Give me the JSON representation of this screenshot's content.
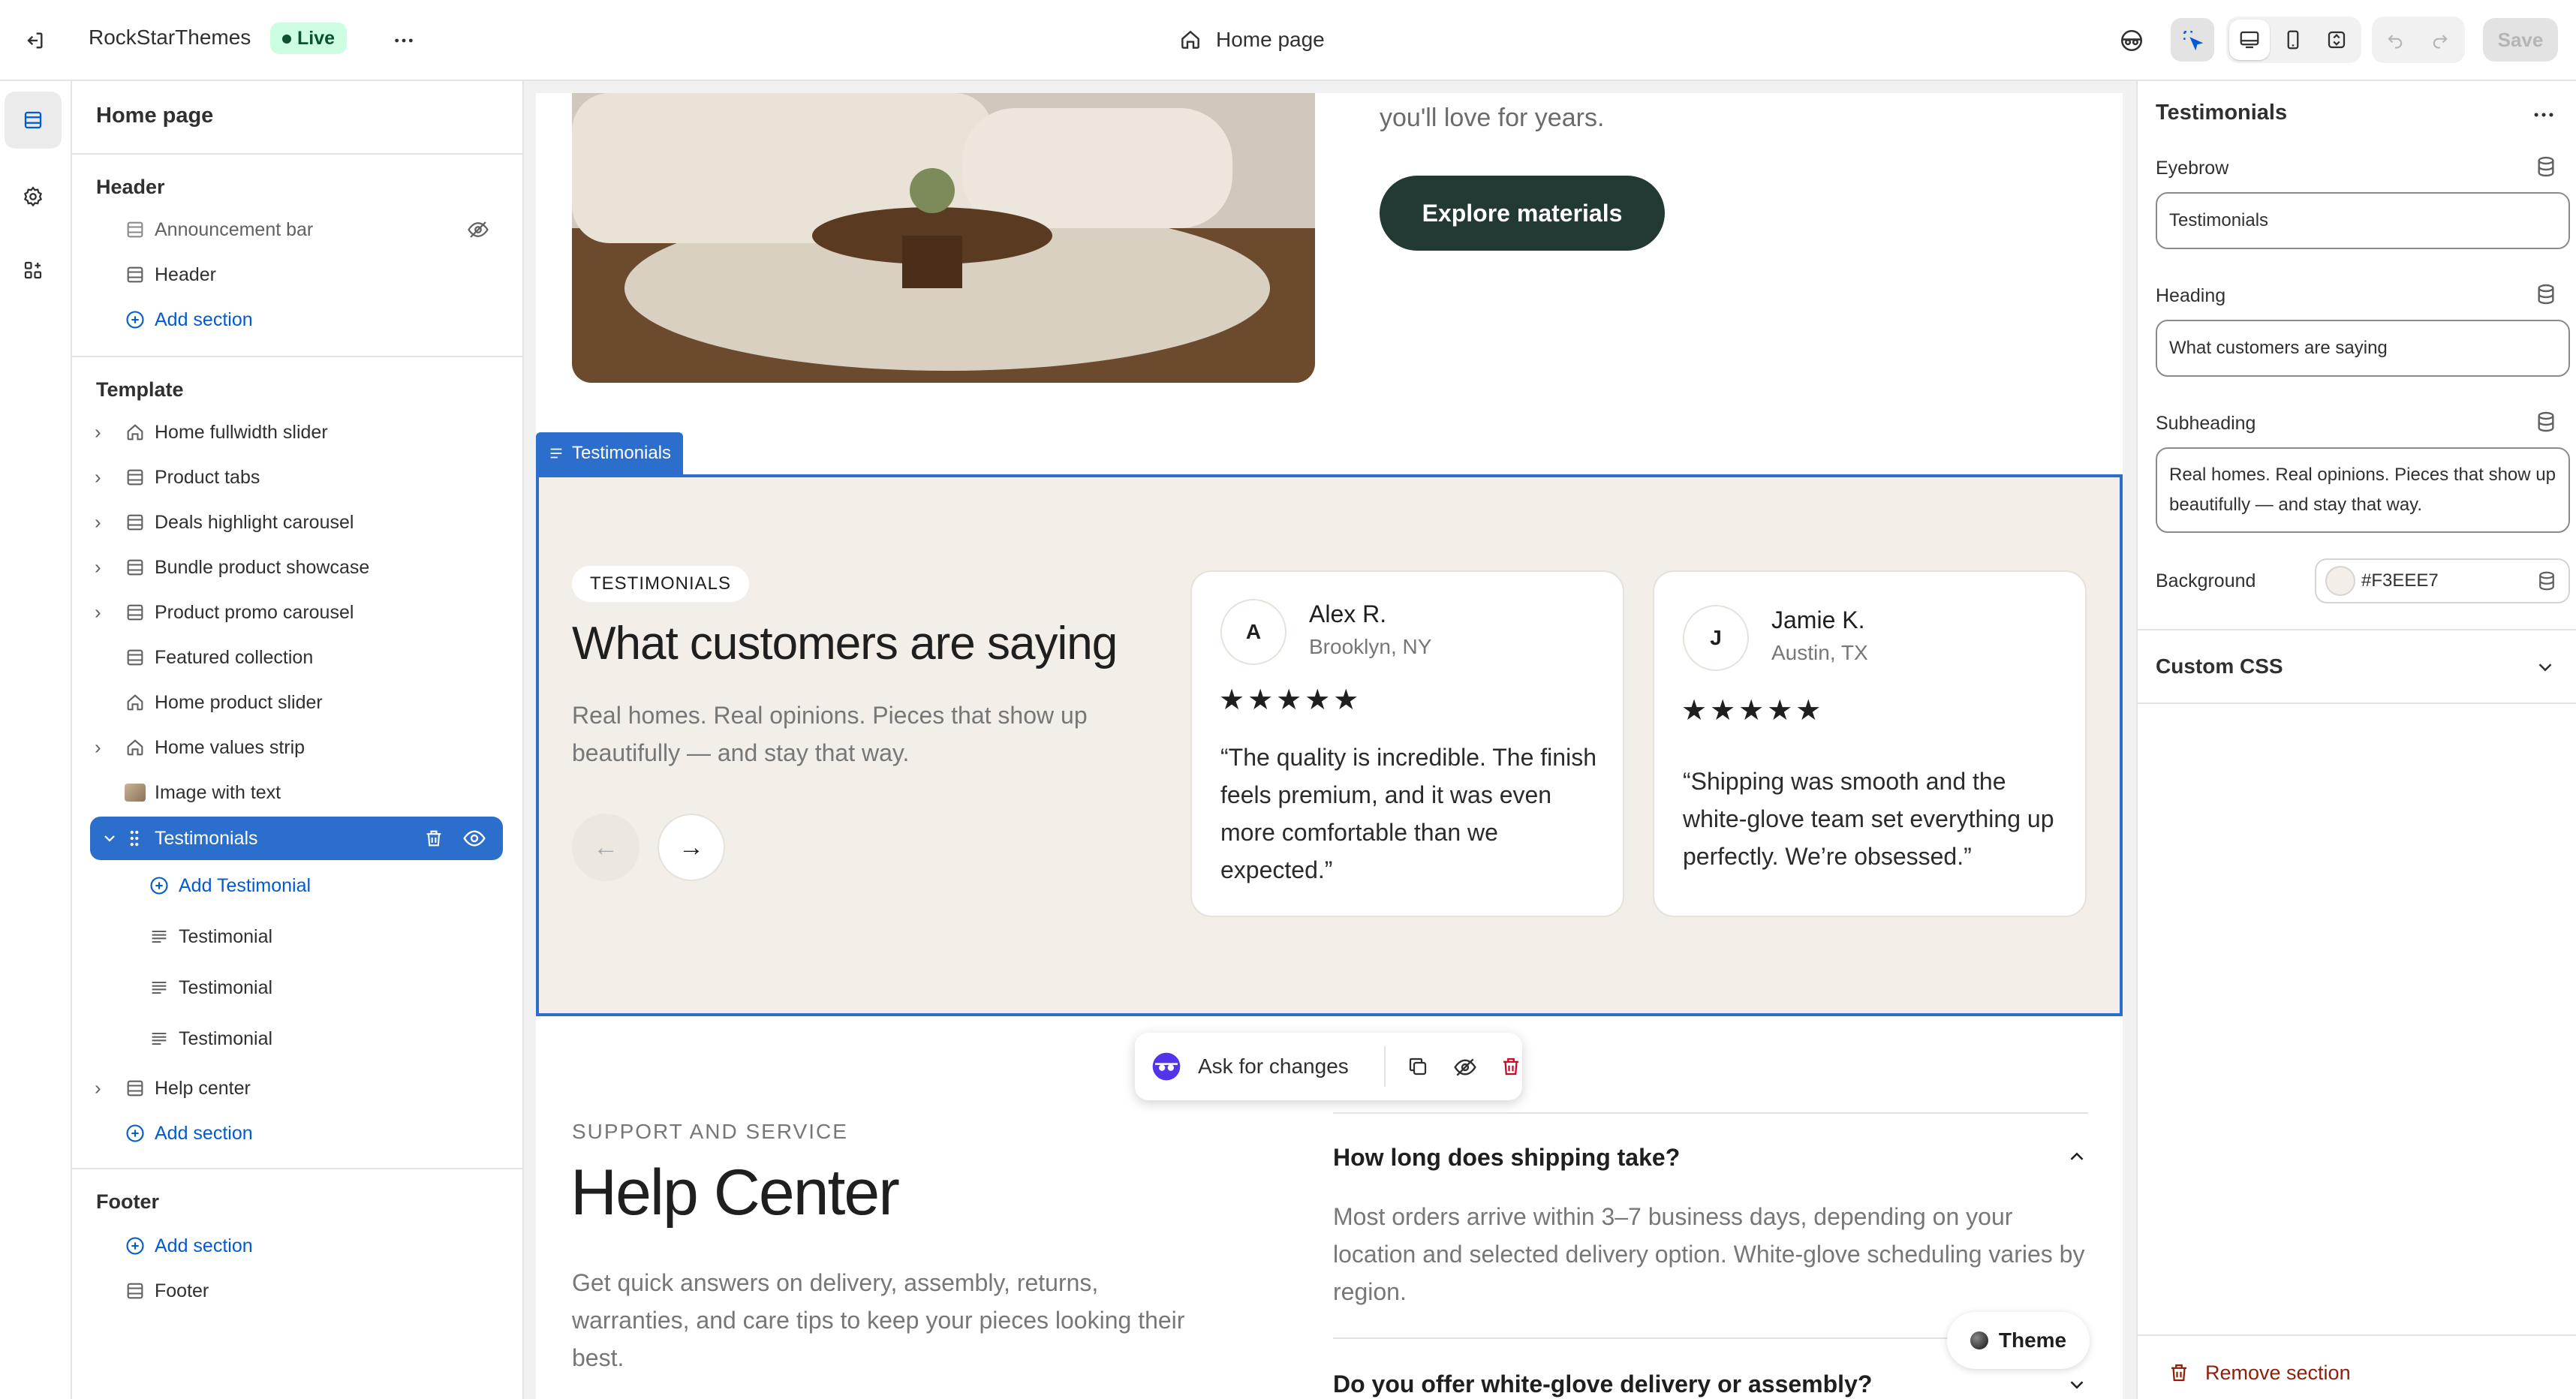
{
  "topbar": {
    "store_name": "RockStarThemes",
    "status": "Live",
    "page": "Home page",
    "save": "Save"
  },
  "sidebar": {
    "page_title": "Home page",
    "header_group": {
      "title": "Header",
      "items": [
        "Announcement bar",
        "Header"
      ],
      "add": "Add section"
    },
    "template_group": {
      "title": "Template",
      "items": [
        "Home fullwidth slider",
        "Product tabs",
        "Deals highlight carousel",
        "Bundle product showcase",
        "Product promo carousel",
        "Featured collection",
        "Home product slider",
        "Home values strip",
        "Image with text",
        "Testimonials"
      ],
      "children": {
        "add": "Add Testimonial",
        "items": [
          "Testimonial",
          "Testimonial",
          "Testimonial"
        ]
      },
      "after": "Help center",
      "add": "Add section"
    },
    "footer_group": {
      "title": "Footer",
      "add": "Add section",
      "items": [
        "Footer"
      ]
    }
  },
  "preview": {
    "hero_text": "you'll love for years.",
    "hero_button": "Explore materials",
    "section_tag": "Testimonials",
    "testimonials": {
      "eyebrow": "TESTIMONIALS",
      "heading": "What customers are saying",
      "subheading": "Real homes. Real opinions. Pieces that show up beautifully — and stay that way.",
      "background": "#F3EEE7",
      "prev_arrow": "←",
      "next_arrow": "→",
      "cards": [
        {
          "initial": "A",
          "name": "Alex R.",
          "location": "Brooklyn, NY",
          "stars": "★★★★★",
          "quote": "“The quality is incredible. The finish feels premium, and it was even more comfortable than we expected.”"
        },
        {
          "initial": "J",
          "name": "Jamie K.",
          "location": "Austin, TX",
          "stars": "★★★★★",
          "quote": "“Shipping was smooth and the white-glove team set everything up perfectly. We’re obsessed.”"
        }
      ]
    },
    "floating_toolbar": {
      "ask": "Ask for changes"
    },
    "help": {
      "eyebrow": "SUPPORT AND SERVICE",
      "heading": "Help Center",
      "text": "Get quick answers on delivery, assembly, returns, warranties, and care tips to keep your pieces looking their best.",
      "faq": [
        {
          "q": "How long does shipping take?",
          "a": "Most orders arrive within 3–7 business days, depending on your location and selected delivery option. White-glove scheduling varies by region."
        },
        {
          "q": "Do you offer white-glove delivery or assembly?"
        }
      ]
    },
    "theme_button": "Theme"
  },
  "settings": {
    "section_title": "Testimonials",
    "eyebrow_label": "Eyebrow",
    "eyebrow_value": "Testimonials",
    "heading_label": "Heading",
    "heading_value": "What customers are saying",
    "subheading_label": "Subheading",
    "subheading_value": "Real homes. Real opinions. Pieces that show up beautifully — and stay that way.",
    "background_label": "Background",
    "background_value": "#F3EEE7",
    "custom_css": "Custom CSS",
    "remove": "Remove section"
  },
  "colors": {
    "accent_blue": "#2c6ecb",
    "button_dark": "#223a33",
    "section_bg": "#F3EEE7",
    "live_badge_bg": "#cdfee1",
    "danger": "#8e1f0b"
  }
}
